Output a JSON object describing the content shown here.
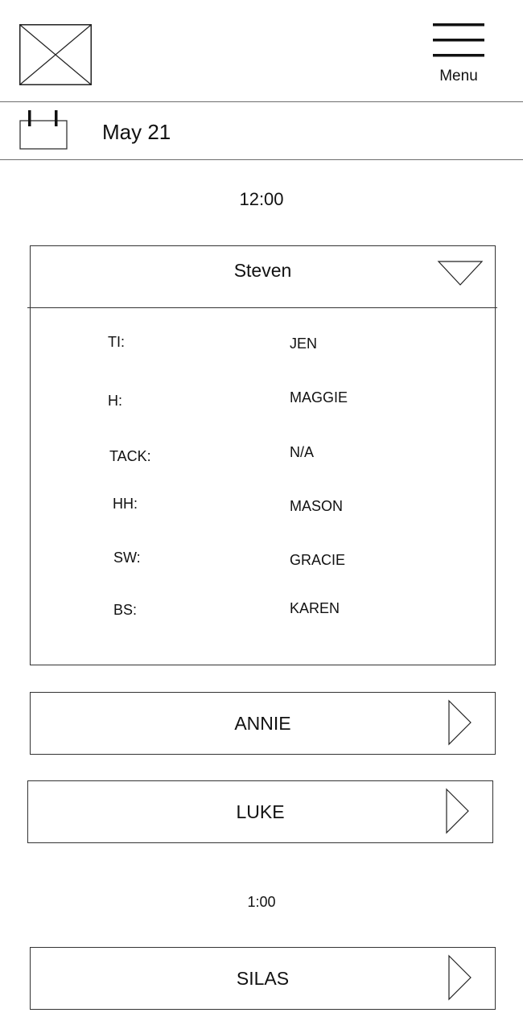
{
  "header": {
    "menu_label": "Menu"
  },
  "date_bar": {
    "date": "May 21"
  },
  "schedule": [
    {
      "time": "12:00",
      "riders": [
        {
          "name": "Steven",
          "expanded": true,
          "assignments": [
            {
              "label": "TI:",
              "value": "JEN"
            },
            {
              "label": "H:",
              "value": "MAGGIE"
            },
            {
              "label": "TACK:",
              "value": "N/A"
            },
            {
              "label": "HH:",
              "value": "MASON"
            },
            {
              "label": "SW:",
              "value": "GRACIE"
            },
            {
              "label": "BS:",
              "value": "KAREN"
            }
          ]
        },
        {
          "name": "ANNIE",
          "expanded": false
        },
        {
          "name": "LUKE",
          "expanded": false
        }
      ]
    },
    {
      "time": "1:00",
      "riders": [
        {
          "name": "SILAS",
          "expanded": false
        }
      ]
    }
  ]
}
